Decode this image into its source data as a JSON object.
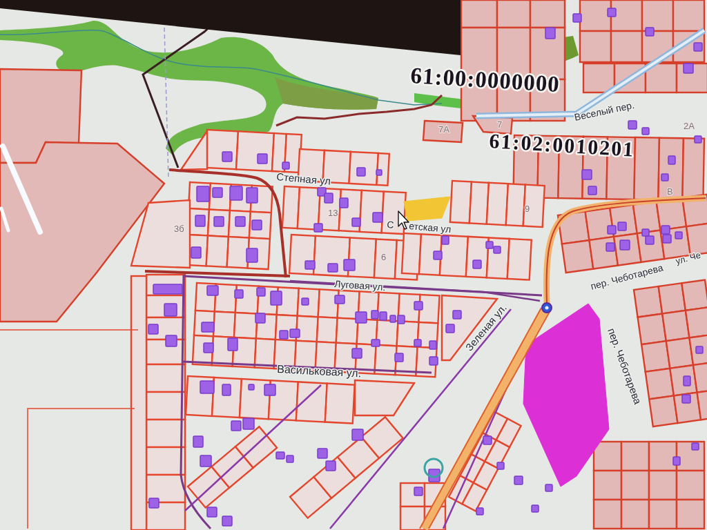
{
  "map": {
    "cadastral_numbers": [
      "61:00:0000000",
      "61:02:0010201"
    ],
    "street_labels": [
      "Степная ул",
      "С",
      "етская ул",
      "Луговая ул.",
      "Васильковая ул.",
      "Зеленая ул.",
      "пер. Чеботарева",
      "ул. Че",
      "пер. Чеботарева",
      "Веселый пер."
    ],
    "parcel_numbers": [
      "7А",
      "7",
      "3б",
      "13",
      "6",
      "9",
      "2А",
      "В"
    ],
    "highlighted_plots": [
      {
        "color": "#f2c534"
      },
      {
        "color": "#dd2fd6"
      }
    ]
  }
}
